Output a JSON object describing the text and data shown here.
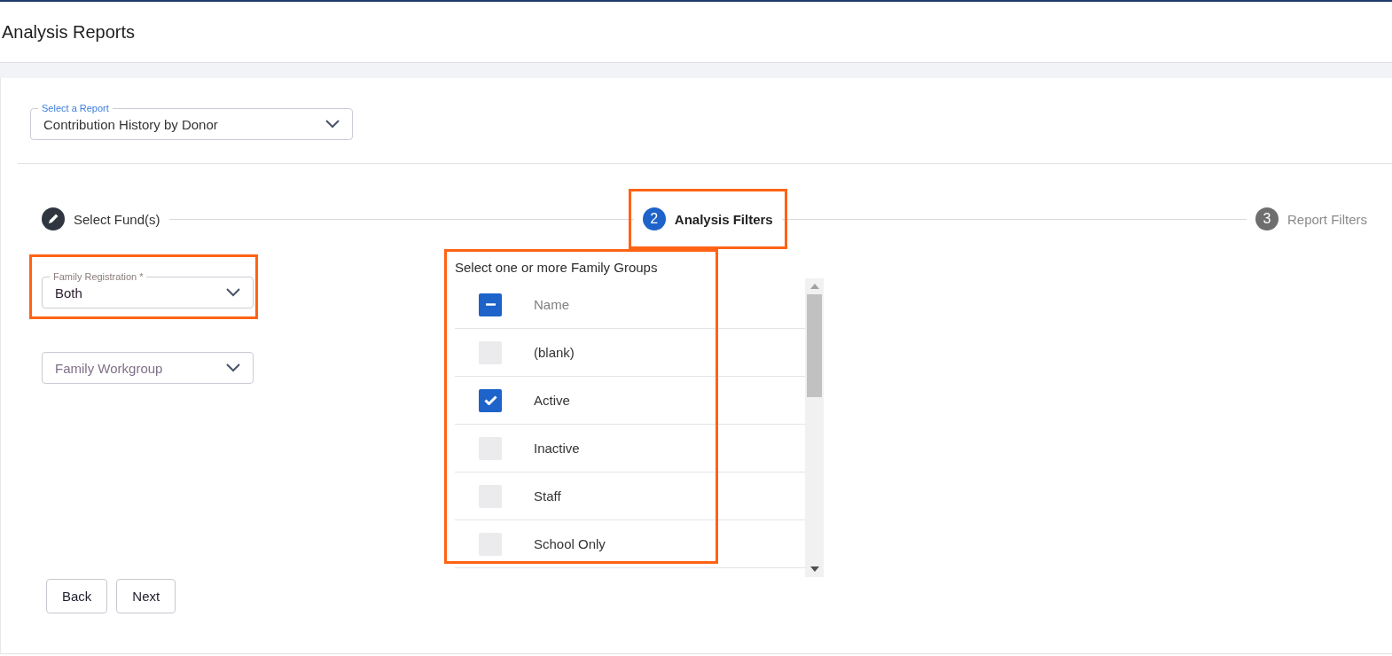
{
  "page": {
    "title": "Analysis Reports"
  },
  "report_select": {
    "label": "Select a Report",
    "value": "Contribution History by Donor"
  },
  "steps": [
    {
      "label": "Select Fund(s)",
      "kind": "done",
      "highlighted": false
    },
    {
      "number": "2",
      "label": "Analysis Filters",
      "kind": "current",
      "highlighted": true
    },
    {
      "number": "3",
      "label": "Report Filters",
      "kind": "upcoming",
      "highlighted": false
    }
  ],
  "family_registration": {
    "label": "Family Registration *",
    "value": "Both",
    "highlighted": true
  },
  "family_workgroup": {
    "placeholder": "Family Workgroup"
  },
  "family_groups": {
    "title": "Select one or more Family Groups",
    "highlighted": true,
    "header": {
      "label": "Name",
      "indeterminate": true
    },
    "rows": [
      {
        "label": "(blank)",
        "checked": false
      },
      {
        "label": "Active",
        "checked": true
      },
      {
        "label": "Inactive",
        "checked": false
      },
      {
        "label": "Staff",
        "checked": false
      },
      {
        "label": "School Only",
        "checked": false
      }
    ]
  },
  "buttons": [
    "Back",
    "Next"
  ]
}
